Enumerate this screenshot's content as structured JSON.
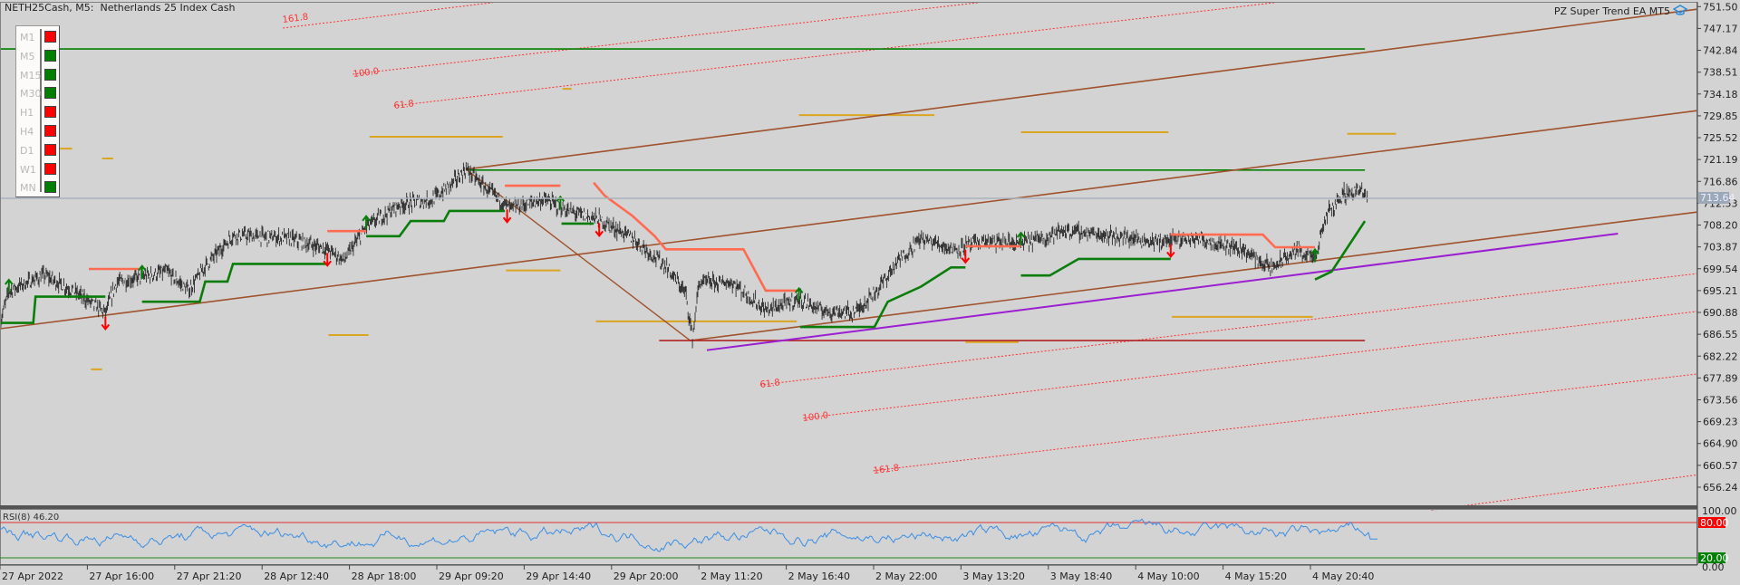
{
  "header": {
    "symbol_title": "NETH25Cash, M5:  Netherlands 25 Index Cash",
    "ea_label": "PZ Super Trend EA MT5"
  },
  "timeframes": [
    {
      "label": "M1",
      "state": "down"
    },
    {
      "label": "M5",
      "state": "up"
    },
    {
      "label": "M15",
      "state": "up"
    },
    {
      "label": "M30",
      "state": "up"
    },
    {
      "label": "H1",
      "state": "down"
    },
    {
      "label": "H4",
      "state": "down"
    },
    {
      "label": "D1",
      "state": "down"
    },
    {
      "label": "W1",
      "state": "down"
    },
    {
      "label": "MN",
      "state": "up"
    }
  ],
  "colors": {
    "up": "#008000",
    "down": "#ff0000",
    "background": "#d3d3d3",
    "candles": "#2b2b2b",
    "supertrend_up": "#0a7d0a",
    "supertrend_down": "#ff6a50",
    "channel": "#a0522d",
    "trendline": "#9b1fd1",
    "fib": "#ff3030",
    "levels": "#daa520",
    "hline": "#008000",
    "rsi": "#3a8ee6"
  },
  "price_axis": {
    "labels": [
      "751.50",
      "747.17",
      "742.84",
      "738.51",
      "734.18",
      "729.85",
      "725.52",
      "721.19",
      "716.86",
      "712.53",
      "708.20",
      "703.87",
      "699.54",
      "695.21",
      "690.88",
      "686.55",
      "682.22",
      "677.89",
      "673.56",
      "669.23",
      "664.90",
      "660.57",
      "656.24"
    ],
    "current_price": "713.64"
  },
  "rsi": {
    "label": "RSI(8) 46.20",
    "current": 46.2,
    "max_label": "100.00",
    "upper_label": "80.00",
    "lower_label": "20.00",
    "min_label": "0.00",
    "upper": 80,
    "lower": 20
  },
  "time_axis": [
    "27 Apr 2022",
    "27 Apr 16:00",
    "27 Apr 21:20",
    "28 Apr 12:40",
    "28 Apr 18:00",
    "29 Apr 09:20",
    "29 Apr 14:40",
    "29 Apr 20:00",
    "2 May 11:20",
    "2 May 16:40",
    "2 May 22:00",
    "3 May 13:20",
    "3 May 18:40",
    "4 May 10:00",
    "4 May 15:20",
    "4 May 20:40"
  ],
  "fib_labels": {
    "upper": [
      "161.8",
      "100.0",
      "61.8"
    ],
    "lower": [
      "61.8",
      "100.0",
      "161.8"
    ]
  },
  "chart_data": {
    "type": "candlestick",
    "symbol": "NETH25Cash",
    "timeframe": "M5",
    "ylim": [
      653,
      753
    ],
    "bars_total": 1530,
    "price_path": [
      [
        0,
        688.6
      ],
      [
        8,
        695.2
      ],
      [
        40,
        698.3
      ],
      [
        70,
        694.6
      ],
      [
        95,
        690.8
      ],
      [
        105,
        696.8
      ],
      [
        150,
        699.0
      ],
      [
        170,
        695.2
      ],
      [
        185,
        700.1
      ],
      [
        210,
        706.2
      ],
      [
        260,
        705.6
      ],
      [
        295,
        703.4
      ],
      [
        310,
        701.2
      ],
      [
        330,
        707.8
      ],
      [
        360,
        712.2
      ],
      [
        390,
        713.3
      ],
      [
        405,
        715.9
      ],
      [
        420,
        719.3
      ],
      [
        440,
        715.0
      ],
      [
        460,
        711.5
      ],
      [
        490,
        713.3
      ],
      [
        510,
        711.1
      ],
      [
        540,
        709.3
      ],
      [
        570,
        705.6
      ],
      [
        600,
        700.1
      ],
      [
        618,
        694.6
      ],
      [
        624,
        685.8
      ],
      [
        630,
        696.8
      ],
      [
        660,
        696.8
      ],
      [
        690,
        691.3
      ],
      [
        720,
        693.5
      ],
      [
        740,
        691.3
      ],
      [
        770,
        690.8
      ],
      [
        790,
        695.2
      ],
      [
        810,
        701.2
      ],
      [
        830,
        705.6
      ],
      [
        860,
        703.4
      ],
      [
        885,
        704.9
      ],
      [
        920,
        704.5
      ],
      [
        960,
        707.1
      ],
      [
        1000,
        706.2
      ],
      [
        1040,
        704.9
      ],
      [
        1080,
        705.6
      ],
      [
        1120,
        703.4
      ],
      [
        1145,
        699.6
      ],
      [
        1170,
        703.4
      ],
      [
        1185,
        701.2
      ],
      [
        1195,
        710.0
      ],
      [
        1210,
        714.4
      ],
      [
        1225,
        715.0
      ],
      [
        1232,
        713.64
      ]
    ],
    "supertrend_up": [
      [
        [
          0,
          688.8
        ],
        [
          30,
          688.8
        ],
        [
          32,
          694
        ],
        [
          95,
          694
        ]
      ],
      [
        [
          128,
          693
        ],
        [
          180,
          693
        ],
        [
          185,
          697
        ],
        [
          205,
          697
        ],
        [
          210,
          700.5
        ],
        [
          295,
          700.5
        ]
      ],
      [
        [
          330,
          706
        ],
        [
          360,
          706
        ],
        [
          370,
          709
        ],
        [
          400,
          709
        ],
        [
          405,
          711
        ],
        [
          455,
          711
        ]
      ],
      [
        [
          506,
          708.5
        ],
        [
          535,
          708.5
        ]
      ],
      [
        [
          721,
          688
        ],
        [
          788,
          688
        ],
        [
          800,
          693
        ],
        [
          830,
          696
        ],
        [
          857,
          699.8
        ],
        [
          870,
          699.8
        ]
      ],
      [
        [
          920,
          698.2
        ],
        [
          946,
          698.2
        ],
        [
          972,
          701.5
        ],
        [
          1055,
          701.5
        ]
      ],
      [
        [
          1185,
          697.4
        ],
        [
          1200,
          699
        ],
        [
          1215,
          704
        ],
        [
          1230,
          709
        ]
      ]
    ],
    "supertrend_down": [
      [
        [
          80,
          699.5
        ],
        [
          125,
          699.5
        ]
      ],
      [
        [
          295,
          707
        ],
        [
          330,
          707
        ]
      ],
      [
        [
          455,
          716
        ],
        [
          505,
          716
        ]
      ],
      [
        [
          535,
          716.6
        ],
        [
          545,
          714
        ],
        [
          570,
          710
        ],
        [
          590,
          706
        ],
        [
          600,
          703.4
        ],
        [
          670,
          703.4
        ],
        [
          690,
          695.2
        ],
        [
          720,
          695.2
        ]
      ],
      [
        [
          870,
          704
        ],
        [
          920,
          704
        ]
      ],
      [
        [
          1055,
          706.3
        ],
        [
          1138,
          706.3
        ],
        [
          1149,
          703.8
        ],
        [
          1185,
          703.8
        ]
      ]
    ],
    "arrows_up": [
      8,
      128,
      330,
      505,
      720,
      920,
      1185
    ],
    "arrows_down": [
      95,
      295,
      457,
      540,
      870,
      1055
    ],
    "objects": {
      "channel": [
        [
          [
            420,
            719.26
          ],
          [
            1530,
            751.0
          ]
        ],
        [
          [
            0,
            687.65
          ],
          [
            1530,
            730.9
          ]
        ],
        [
          [
            622,
            685.3
          ],
          [
            1530,
            710.8
          ]
        ]
      ],
      "diagonal": [
        [
          420,
          719.26
        ],
        [
          622,
          685.3
        ]
      ],
      "support_line": {
        "from": 594,
        "to": 1230,
        "price": 685.3
      },
      "trendline": [
        [
          637,
          683.4
        ],
        [
          1458,
          706.5
        ]
      ],
      "hlines": [
        {
          "from": 0,
          "to": 1230,
          "price": 743.1
        },
        {
          "from": 420,
          "to": 1230,
          "price": 719.1
        }
      ],
      "fib_upper": [
        [
          [
            255,
            747.25
          ],
          [
            444,
            752.3
          ]
        ],
        [
          [
            318,
            738.1
          ],
          [
            882,
            752.3
          ]
        ],
        [
          [
            355,
            731.8
          ],
          [
            1149,
            752.3
          ]
        ]
      ],
      "fib_lower": [
        [
          [
            685,
            676.5
          ],
          [
            1530,
            698.6
          ]
        ],
        [
          [
            724,
            669.9
          ],
          [
            1530,
            691.1
          ]
        ],
        [
          [
            787,
            659.5
          ],
          [
            1530,
            678.7
          ]
        ],
        [
          [
            1290,
            651.7
          ],
          [
            1530,
            658.7
          ]
        ]
      ],
      "levels": [
        [
          22,
          65,
          723.35
        ],
        [
          92,
          102,
          721.4
        ],
        [
          296,
          332,
          686.4
        ],
        [
          82,
          92,
          679.6
        ],
        [
          333,
          453,
          725.7
        ],
        [
          456,
          505,
          699.2
        ],
        [
          507,
          515,
          735.2
        ],
        [
          537,
          718,
          689.1
        ],
        [
          720,
          842,
          730.0
        ],
        [
          870,
          918,
          685.0
        ],
        [
          920,
          1053,
          726.6
        ],
        [
          1056,
          1183,
          690.0
        ],
        [
          1214,
          1258,
          726.3
        ]
      ]
    }
  }
}
